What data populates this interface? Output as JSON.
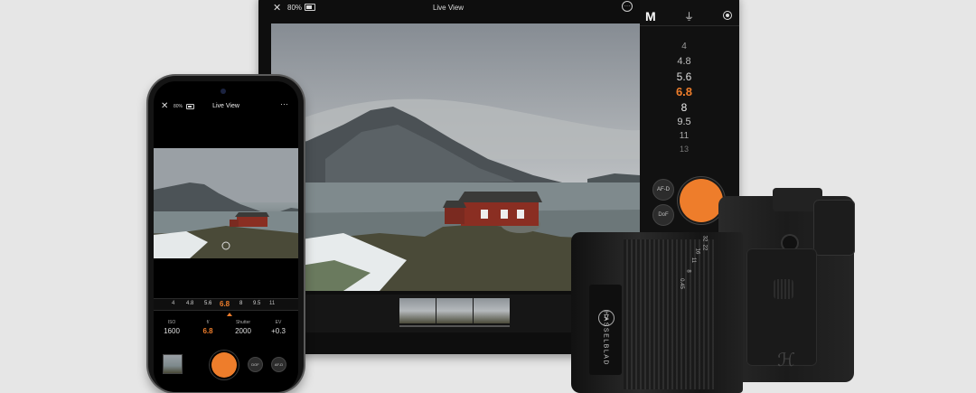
{
  "tablet": {
    "battery": "80%",
    "title": "Live View",
    "mode": "M",
    "aperture_wheel": [
      "4",
      "4.8",
      "5.6",
      "6.8",
      "8",
      "9.5",
      "11",
      "13"
    ],
    "selected_aperture": "6.8",
    "af_label": "AF-D",
    "dof_label": "DoF"
  },
  "phone": {
    "battery": "80%",
    "title": "Live View",
    "aperture_strip": [
      "4",
      "4.8",
      "5.6",
      "6.8",
      "8",
      "9.5",
      "11"
    ],
    "selected_aperture": "6.8",
    "params": [
      {
        "label": "ISO",
        "value": "1600"
      },
      {
        "label": "f/",
        "value": "6.8"
      },
      {
        "label": "Shutter",
        "value": "2000"
      },
      {
        "label": "EV",
        "value": "+0.3"
      }
    ],
    "dof_label": "DOF",
    "af_label": "AF-D"
  },
  "camera": {
    "brand": "HASSELBLAD",
    "lens_scale": [
      "0.45",
      "8",
      "11",
      "16",
      "22",
      "32"
    ]
  },
  "colors": {
    "accent": "#ee7d2b",
    "background": "#e6e6e6"
  }
}
